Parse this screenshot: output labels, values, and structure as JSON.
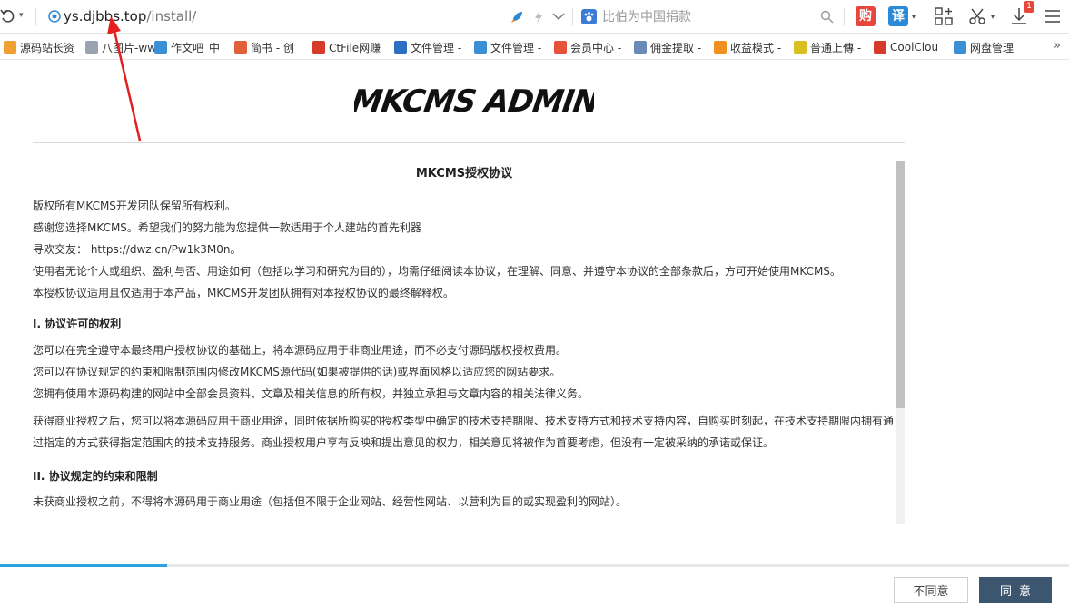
{
  "browser": {
    "url_host": "ys.djbbs.top",
    "url_path": "/install/",
    "search_placeholder": "比伯为中国捐款",
    "tools": {
      "shop_label": "购",
      "translate_label": "译",
      "download_badge": "1"
    }
  },
  "bookmarks": [
    {
      "label": "源码站长资",
      "color": "#f0a030"
    },
    {
      "label": "八图片-ww",
      "color": "#9aa4b0"
    },
    {
      "label": "作文吧_中",
      "color": "#3b8fd4"
    },
    {
      "label": "简书 - 创",
      "color": "#e0603a"
    },
    {
      "label": "CtFile网赚",
      "color": "#d83a2a"
    },
    {
      "label": "文件管理 -",
      "color": "#2e6fc4"
    },
    {
      "label": "文件管理 -",
      "color": "#3b8fd4"
    },
    {
      "label": "会员中心 -",
      "color": "#e8513a"
    },
    {
      "label": "佣金提取 -",
      "color": "#6a8bb8"
    },
    {
      "label": "收益模式 -",
      "color": "#f09020"
    },
    {
      "label": "普通上傳 -",
      "color": "#d8c020"
    },
    {
      "label": "CoolClou",
      "color": "#d83a2a"
    },
    {
      "label": "网盘管理",
      "color": "#3b8fd4"
    }
  ],
  "page": {
    "logo_text": "MKCMS ADMIN",
    "license": {
      "title": "MKCMS授权协议",
      "intro": [
        "版权所有MKCMS开发团队保留所有权利。",
        "感谢您选择MKCMS。希望我们的努力能为您提供一款适用于个人建站的首先利器",
        "寻欢交友：  https://dwz.cn/Pw1k3M0n。",
        "使用者无论个人或组织、盈利与否、用途如何（包括以学习和研究为目的），均需仔细阅读本协议，在理解、同意、并遵守本协议的全部条款后，方可开始使用MKCMS。",
        "本授权协议适用且仅适用于本产品，MKCMS开发团队拥有对本授权协议的最终解释权。"
      ],
      "section1_title": "I. 协议许可的权利",
      "section1": [
        "您可以在完全遵守本最终用户授权协议的基础上，将本源码应用于非商业用途，而不必支付源码版权授权费用。",
        "您可以在协议规定的约束和限制范围内修改MKCMS源代码(如果被提供的话)或界面风格以适应您的网站要求。",
        "您拥有使用本源码构建的网站中全部会员资料、文章及相关信息的所有权，并独立承担与文章内容的相关法律义务。"
      ],
      "section1_commercial": "获得商业授权之后，您可以将本源码应用于商业用途，同时依据所购买的授权类型中确定的技术支持期限、技术支持方式和技术支持内容，自购买时刻起，在技术支持期限内拥有通过指定的方式获得指定范围内的技术支持服务。商业授权用户享有反映和提出意见的权力，相关意见将被作为首要考虑，但没有一定被采纳的承诺或保证。",
      "section2_title": "II. 协议规定的约束和限制",
      "section2": [
        "未获商业授权之前，不得将本源码用于商业用途（包括但不限于企业网站、经营性网站、以营利为目的或实现盈利的网站）。"
      ]
    },
    "progress_fraction": 0.156,
    "buttons": {
      "disagree": "不同意",
      "agree": "同意"
    }
  }
}
